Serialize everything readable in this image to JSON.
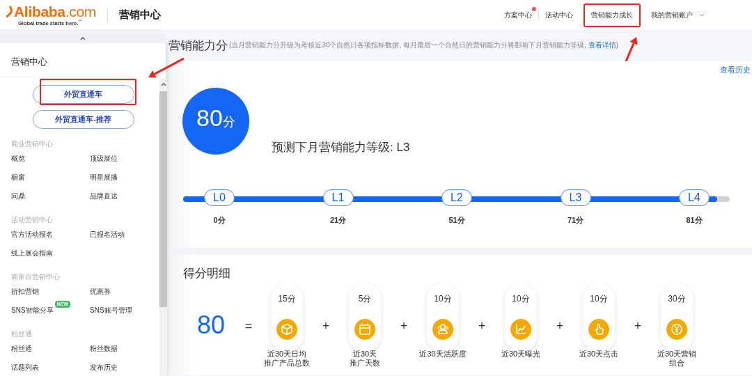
{
  "header": {
    "logo": "**Alibaba**.com",
    "tagline": "Global trade starts here.$^{™}$",
    "title": "营销中心",
    "nav": [
      {
        "label": "方案中心",
        "notification": true,
        "highlighted": false
      },
      {
        "label": "活动中心",
        "notification": false,
        "highlighted": false
      },
      {
        "label": "营销能力成长",
        "notification": false,
        "highlighted": true
      },
      {
        "label": "我的营销账户",
        "notification": false,
        "highlighted": false
      }
    ]
  },
  "sidebar": {
    "title": "营销中心",
    "buttons": [
      {
        "label": "外贸直通车",
        "highlighted": true
      },
      {
        "label": "外贸直通车-推荐",
        "highlighted": false
      }
    ],
    "groups": [
      {
        "heading": "商业营销中心",
        "items": [
          {
            "label": "概览"
          },
          {
            "label": "顶级展位"
          },
          {
            "label": "橱窗"
          },
          {
            "label": "明星展播"
          },
          {
            "label": "问鼎"
          },
          {
            "label": "品牌直达"
          }
        ]
      },
      {
        "heading": "活动营销中心",
        "items": [
          {
            "label": "官方活动报名"
          },
          {
            "label": "已报名活动"
          },
          {
            "label": "线上展会指南"
          }
        ]
      },
      {
        "heading": "商家自营销中心",
        "items": [
          {
            "label": "折扣营销"
          },
          {
            "label": "优惠券"
          },
          {
            "label": "SNS智能分享",
            "badge": "NEW"
          },
          {
            "label": "SNS账号管理"
          }
        ]
      },
      {
        "heading": "粉丝通",
        "items": [
          {
            "label": "粉丝通"
          },
          {
            "label": "粉丝数据"
          },
          {
            "label": "话题列表"
          },
          {
            "label": "发布历史"
          }
        ]
      }
    ]
  },
  "page": {
    "title": "营销能力分",
    "note": "(当月营销能力分升级为考核近30个自然日各项指标数据, 每月最后一个自然日的营销能力分将影响下月营销能力等级, ",
    "note_link": "查看详情",
    "note_end": ")"
  },
  "score": {
    "history_link": "查看历史",
    "value": "80",
    "unit": "分",
    "prediction": "预测下月营销能力等级: L3"
  },
  "levels": {
    "level": 0.977,
    "stops": [
      {
        "label": "L0",
        "score": "0分"
      },
      {
        "label": "L1",
        "score": "21分"
      },
      {
        "label": "L2",
        "score": "51分"
      },
      {
        "label": "L3",
        "score": "71分"
      },
      {
        "label": "L4",
        "score": "81分"
      }
    ]
  },
  "breakdown": {
    "title": "得分明细",
    "total": "80",
    "equals": "=",
    "items": [
      {
        "points": "15分",
        "label_lines": [
          "近30天日均",
          "推广产品总数"
        ]
      },
      {
        "operator": "+",
        "points": "5分",
        "label_lines": [
          "近30天",
          "推广天数"
        ]
      },
      {
        "operator": "+",
        "points": "10分",
        "label_lines": [
          "近30天活跃度"
        ]
      },
      {
        "operator": "+",
        "points": "10分",
        "label_lines": [
          "近30天曝光"
        ]
      },
      {
        "operator": "+",
        "points": "10分",
        "label_lines": [
          "近30天点击"
        ]
      },
      {
        "operator": "+",
        "points": "30分",
        "label_lines": [
          "近30天营销",
          "组合"
        ]
      }
    ]
  }
}
